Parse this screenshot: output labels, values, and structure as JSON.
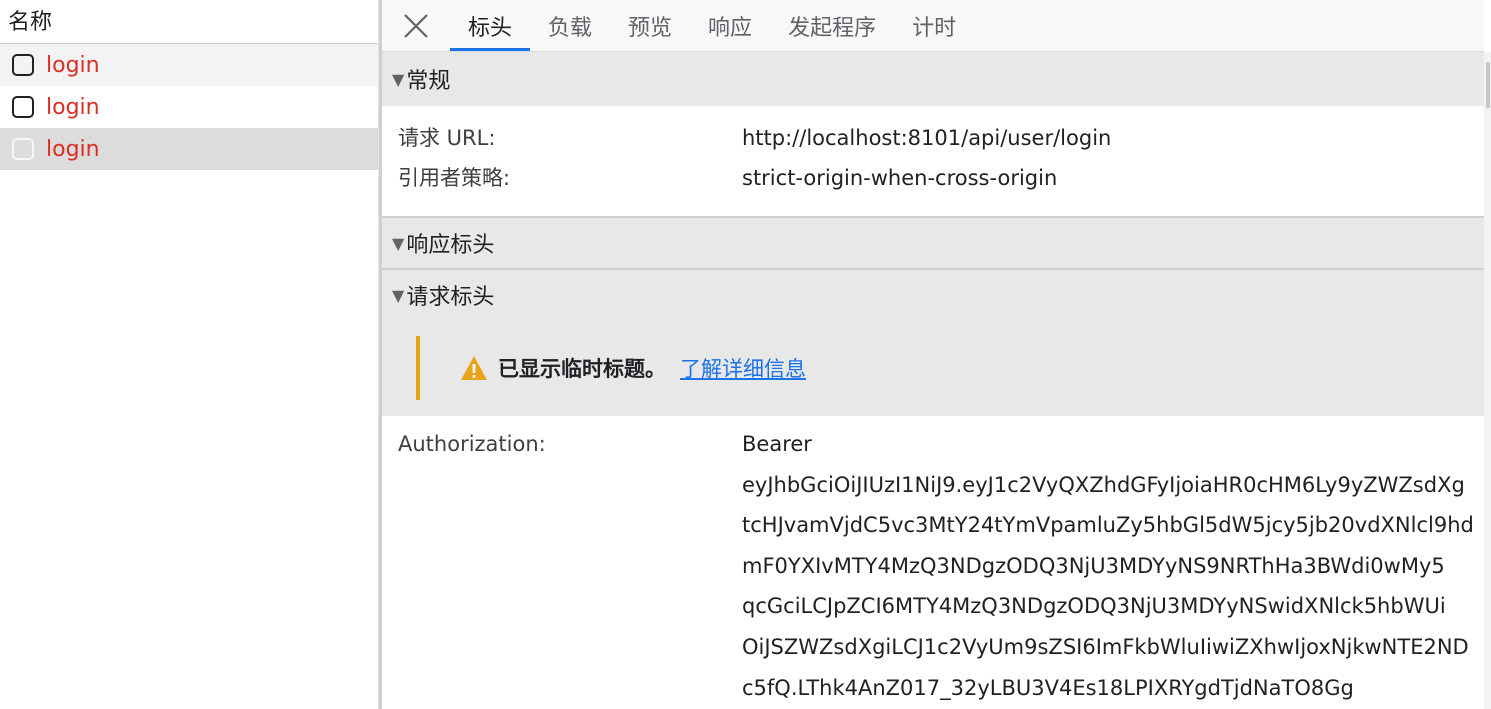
{
  "request_list": {
    "header": "名称",
    "rows": [
      {
        "name": "login"
      },
      {
        "name": "login"
      },
      {
        "name": "login"
      }
    ]
  },
  "tabs": [
    "标头",
    "负载",
    "预览",
    "响应",
    "发起程序",
    "计时"
  ],
  "active_tab": "标头",
  "general": {
    "title": "常规",
    "request_url_label": "请求 URL:",
    "request_url": "http://localhost:8101/api/user/login",
    "referrer_policy_label": "引用者策略:",
    "referrer_policy": "strict-origin-when-cross-origin"
  },
  "response_headers": {
    "title": "响应标头"
  },
  "request_headers": {
    "title": "请求标头",
    "warning_text": "已显示临时标题。",
    "learn_more": "了解详细信息",
    "authorization_label": "Authorization:",
    "authorization_lines": [
      "Bearer",
      "eyJhbGciOiJIUzI1NiJ9.eyJ1c2VyQXZhdGFyIjoiaHR0cHM6Ly9yZWZsdXg",
      "tcHJvamVjdC5vc3MtY24tYmVpamluZy5hbGl5dW5jcy5jb20vdXNlcl9hd",
      "mF0YXIvMTY4MzQ3NDgzODQ3NjU3MDYyNS9NRThHa3BWdi0wMy5",
      "qcGciLCJpZCI6MTY4MzQ3NDgzODQ3NjU3MDYyNSwidXNlck5hbWUi",
      "OiJSZWZsdXgiLCJ1c2VyUm9sZSI6ImFkbWluIiwiZXhwIjoxNjkwNTE2ND",
      "c5fQ.LThk4AnZ017_32yLBU3V4Es18LPIXRYgdTjdNaTO8Gg"
    ]
  },
  "colors": {
    "error_red": "#d93025",
    "accent_blue": "#1a73e8",
    "warning_orange": "#e8a317"
  }
}
